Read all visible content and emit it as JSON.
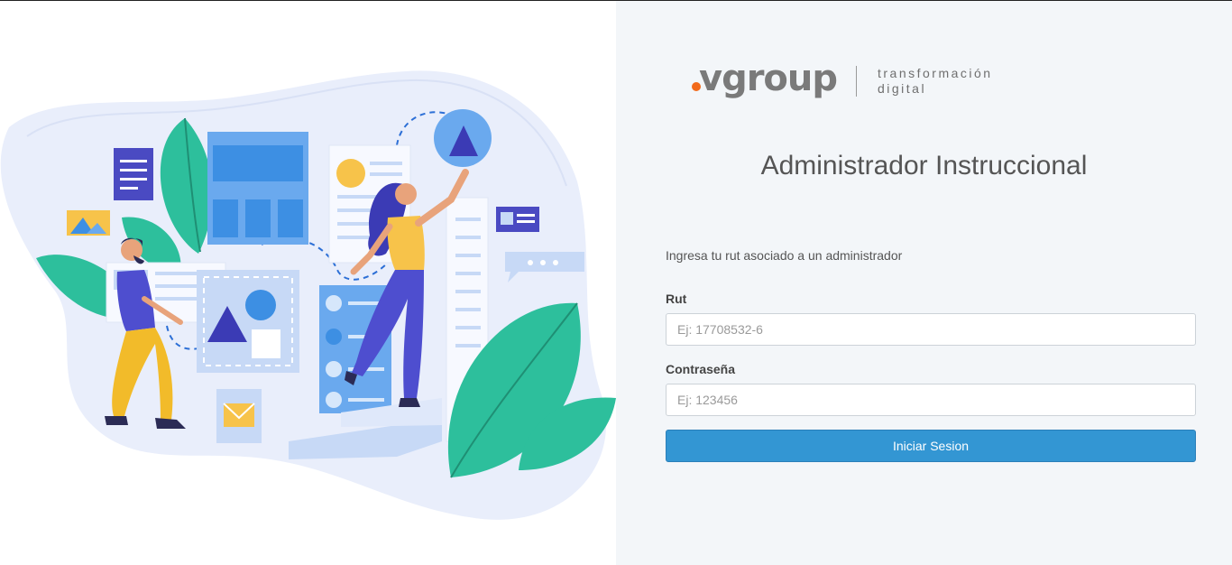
{
  "brand": {
    "logo_text": "vgroup",
    "tagline_line1": "transformación",
    "tagline_line2": "digital",
    "accent_color": "#f26a1b"
  },
  "login": {
    "title": "Administrador Instruccional",
    "instruction": "Ingresa tu rut asociado a un administrador",
    "rut_label": "Rut",
    "rut_placeholder": "Ej: 17708532-6",
    "password_label": "Contraseña",
    "password_placeholder": "Ej: 123456",
    "submit_label": "Iniciar Sesion",
    "button_color": "#3396d3"
  }
}
